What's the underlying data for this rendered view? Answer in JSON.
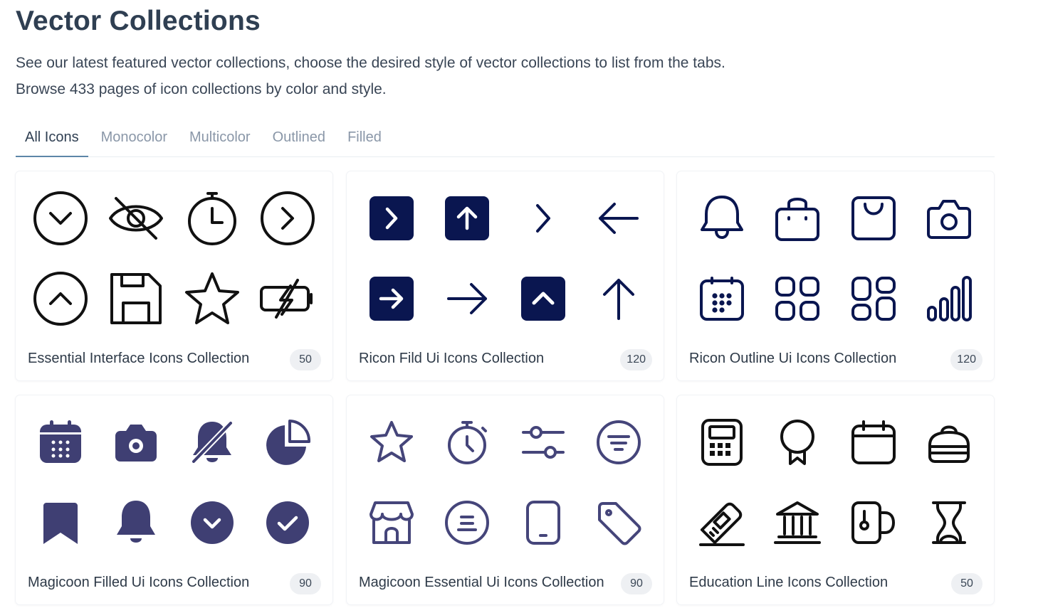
{
  "page": {
    "title": "Vector Collections",
    "description_line1": "See our latest featured vector collections, choose the desired style of vector collections to list from the tabs.",
    "description_line2": "Browse 433 pages of icon collections by color and style."
  },
  "tabs": [
    {
      "label": "All Icons",
      "active": true
    },
    {
      "label": "Monocolor",
      "active": false
    },
    {
      "label": "Multicolor",
      "active": false
    },
    {
      "label": "Outlined",
      "active": false
    },
    {
      "label": "Filled",
      "active": false
    }
  ],
  "colors": {
    "black": "#111111",
    "navy": "#0a1650",
    "indigo": "#3f3f73",
    "indigo_line": "#45457a",
    "active_tab_underline": "#5d86a8"
  },
  "collections": [
    {
      "name": "Essential Interface Icons Collection",
      "count": "50",
      "icons": [
        "chevron-down-circle-icon",
        "eye-off-icon",
        "stopwatch-icon",
        "chevron-right-circle-icon",
        "chevron-up-circle-icon",
        "floppy-disk-icon",
        "star-icon",
        "battery-charging-icon"
      ]
    },
    {
      "name": "Ricon Fild Ui Icons Collection",
      "count": "120",
      "icons": [
        "chevron-right-square-icon",
        "arrow-up-square-icon",
        "chevron-right-icon",
        "arrow-left-icon",
        "arrow-right-square-icon",
        "arrow-right-icon",
        "chevron-up-square-icon",
        "arrow-up-icon"
      ]
    },
    {
      "name": "Ricon Outline Ui Icons Collection",
      "count": "120",
      "icons": [
        "bell-icon",
        "shopping-bag-icon",
        "shopping-bag-alt-icon",
        "camera-icon",
        "calendar-icon",
        "grid-icon",
        "grid-alt-icon",
        "signal-bars-icon"
      ]
    },
    {
      "name": "Magicoon Filled Ui Icons Collection",
      "count": "90",
      "icons": [
        "calendar-icon",
        "camera-icon",
        "bell-off-icon",
        "pie-chart-icon",
        "bookmark-icon",
        "bell-icon",
        "chevron-down-circle-icon",
        "check-circle-icon"
      ]
    },
    {
      "name": "Magicoon Essential Ui Icons Collection",
      "count": "90",
      "icons": [
        "star-icon",
        "stopwatch-icon",
        "sliders-icon",
        "filter-circle-icon",
        "store-icon",
        "menu-circle-icon",
        "tablet-icon",
        "tag-icon"
      ]
    },
    {
      "name": "Education Line Icons Collection",
      "count": "50",
      "icons": [
        "calculator-icon",
        "award-icon",
        "calendar-icon",
        "bag-icon",
        "ruler-icon",
        "bank-icon",
        "mug-icon",
        "hourglass-icon"
      ]
    }
  ]
}
